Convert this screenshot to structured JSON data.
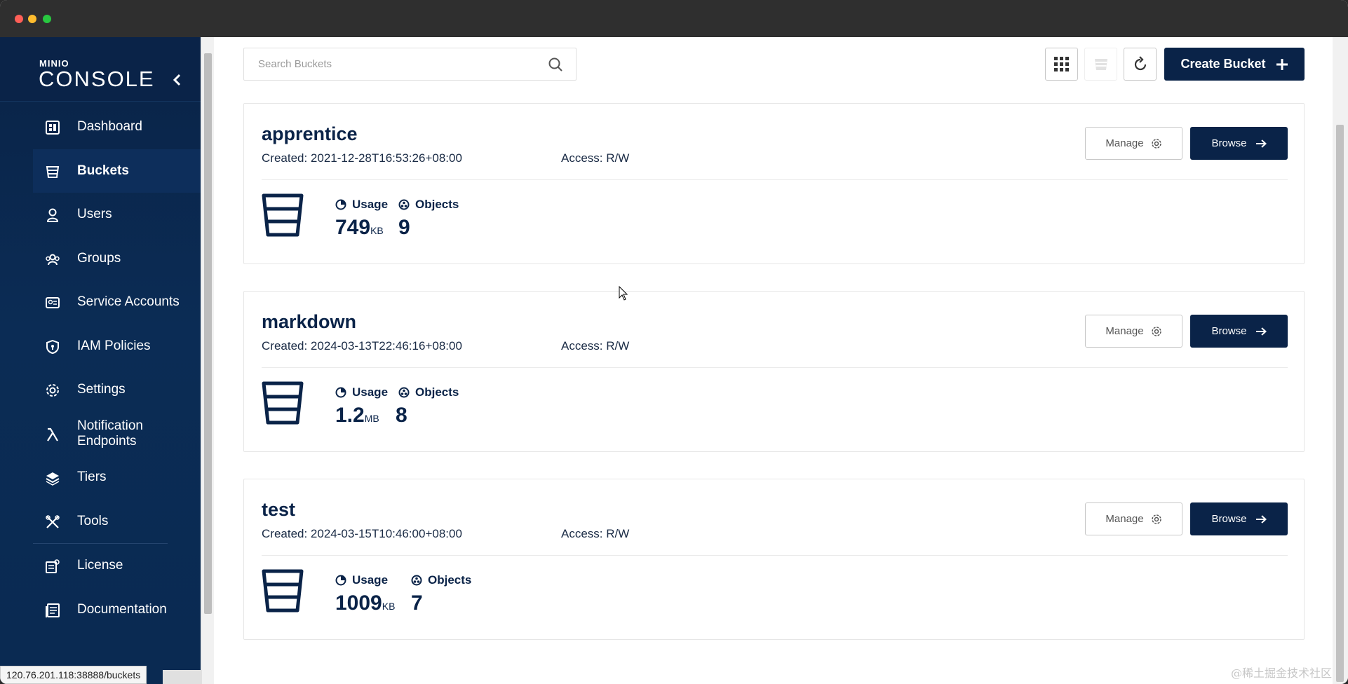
{
  "window": {
    "title": ""
  },
  "sidebar": {
    "logo_small": "MINIO",
    "logo_big": "CONSOLE",
    "collapse": "‹",
    "items": [
      {
        "label": "Dashboard",
        "icon": "dashboard-icon"
      },
      {
        "label": "Buckets",
        "icon": "bucket-icon",
        "active": true
      },
      {
        "label": "Users",
        "icon": "user-icon"
      },
      {
        "label": "Groups",
        "icon": "groups-icon"
      },
      {
        "label": "Service Accounts",
        "icon": "service-accounts-icon"
      },
      {
        "label": "IAM Policies",
        "icon": "shield-icon"
      },
      {
        "label": "Settings",
        "icon": "gear-icon"
      },
      {
        "label": "Notification Endpoints",
        "icon": "lambda-icon"
      },
      {
        "label": "Tiers",
        "icon": "layers-icon"
      },
      {
        "label": "Tools",
        "icon": "tools-icon"
      },
      {
        "label": "License",
        "icon": "license-icon"
      },
      {
        "label": "Documentation",
        "icon": "documentation-icon"
      }
    ]
  },
  "toolbar": {
    "search_placeholder": "Search Buckets",
    "create_label": "Create Bucket"
  },
  "buckets": [
    {
      "name": "apprentice",
      "created": "Created: 2021-12-28T16:53:26+08:00",
      "access": "Access: R/W",
      "usage_label": "Usage",
      "usage_value": "749",
      "usage_unit": "KB",
      "objects_label": "Objects",
      "objects_value": "9",
      "manage": "Manage",
      "browse": "Browse"
    },
    {
      "name": "markdown",
      "created": "Created: 2024-03-13T22:46:16+08:00",
      "access": "Access: R/W",
      "usage_label": "Usage",
      "usage_value": "1.2",
      "usage_unit": "MB",
      "objects_label": "Objects",
      "objects_value": "8",
      "manage": "Manage",
      "browse": "Browse"
    },
    {
      "name": "test",
      "created": "Created: 2024-03-15T10:46:00+08:00",
      "access": "Access: R/W",
      "usage_label": "Usage",
      "usage_value": "1009",
      "usage_unit": "KB",
      "objects_label": "Objects",
      "objects_value": "7",
      "manage": "Manage",
      "browse": "Browse"
    }
  ],
  "status_bar": {
    "url": "120.76.201.118:38888/buckets"
  },
  "watermark": "@稀土掘金技术社区",
  "colors": {
    "brand": "#0a2348",
    "accent": "#0b2c55"
  }
}
